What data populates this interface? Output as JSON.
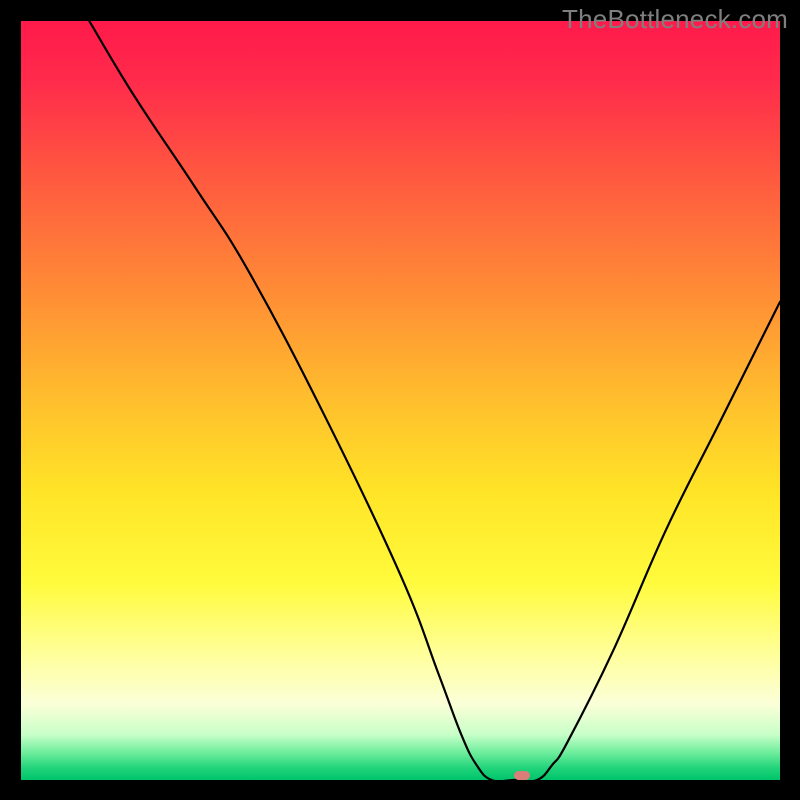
{
  "watermark": "TheBottleneck.com",
  "chart_data": {
    "type": "line",
    "title": "",
    "xlabel": "",
    "ylabel": "",
    "xlim": [
      0,
      100
    ],
    "ylim": [
      0,
      100
    ],
    "x": [
      9,
      15,
      23,
      30,
      40,
      50,
      55,
      58,
      60,
      62,
      65,
      68,
      70,
      72,
      78,
      85,
      92,
      100
    ],
    "values": [
      100,
      90,
      78,
      67,
      48,
      27,
      14,
      6,
      2,
      0,
      0,
      0,
      2,
      5,
      17,
      33,
      47,
      63
    ],
    "gradient_stops": [
      {
        "pos": 0.0,
        "color": "#ff1a4b"
      },
      {
        "pos": 0.08,
        "color": "#ff2b4b"
      },
      {
        "pos": 0.2,
        "color": "#ff5740"
      },
      {
        "pos": 0.35,
        "color": "#ff8a36"
      },
      {
        "pos": 0.5,
        "color": "#ffbf2d"
      },
      {
        "pos": 0.62,
        "color": "#ffe427"
      },
      {
        "pos": 0.74,
        "color": "#fffb3c"
      },
      {
        "pos": 0.84,
        "color": "#ffffa0"
      },
      {
        "pos": 0.9,
        "color": "#fbffd8"
      },
      {
        "pos": 0.94,
        "color": "#c8ffc8"
      },
      {
        "pos": 0.965,
        "color": "#6aec9a"
      },
      {
        "pos": 0.985,
        "color": "#1fd37a"
      },
      {
        "pos": 1.0,
        "color": "#00c46a"
      }
    ],
    "marker": {
      "x": 66,
      "y": 0,
      "w": 2.2,
      "h": 1.2
    }
  }
}
